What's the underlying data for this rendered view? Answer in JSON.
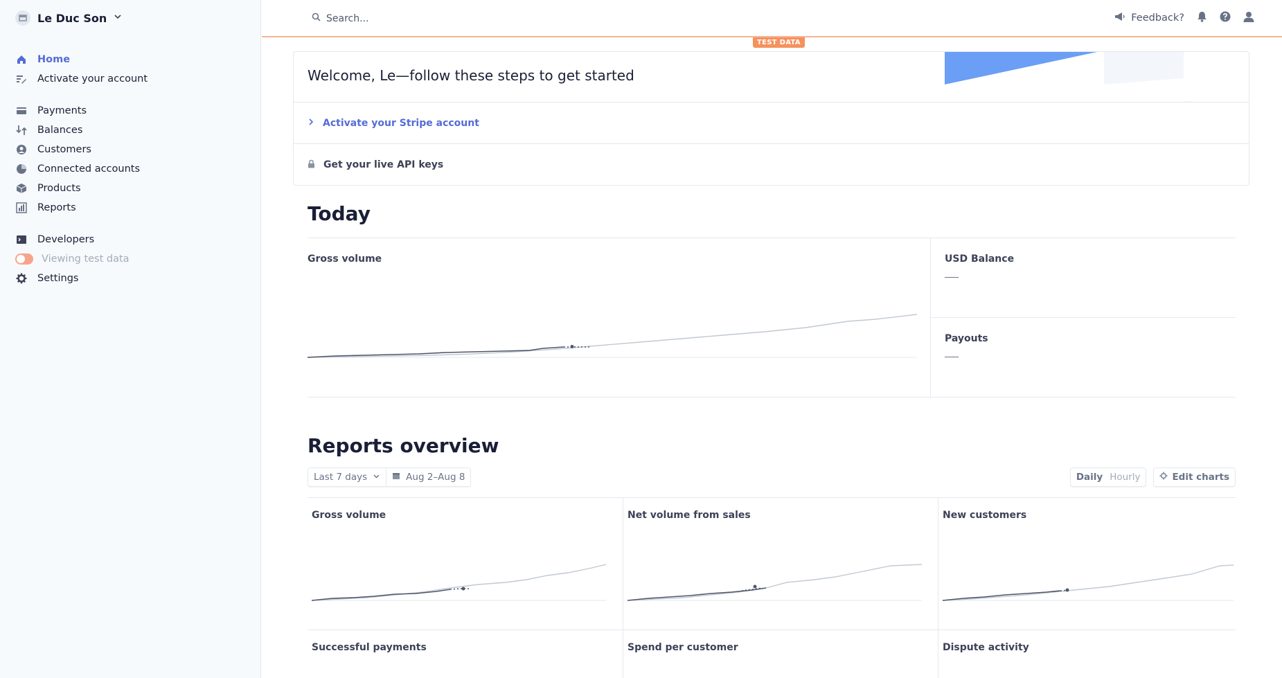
{
  "account": {
    "name": "Le Duc Son"
  },
  "sidebar": {
    "items": [
      {
        "label": "Home",
        "icon": "home-icon",
        "state": "active"
      },
      {
        "label": "Activate your account",
        "icon": "edit-list-icon"
      },
      {
        "label": "Payments",
        "icon": "payments-icon"
      },
      {
        "label": "Balances",
        "icon": "balances-icon"
      },
      {
        "label": "Customers",
        "icon": "customers-icon"
      },
      {
        "label": "Connected accounts",
        "icon": "connected-accounts-icon"
      },
      {
        "label": "Products",
        "icon": "products-icon"
      },
      {
        "label": "Reports",
        "icon": "reports-icon"
      },
      {
        "label": "Developers",
        "icon": "terminal-icon"
      },
      {
        "label": "Viewing test data",
        "icon": "toggle",
        "state": "on"
      },
      {
        "label": "Settings",
        "icon": "gear-icon"
      }
    ]
  },
  "topbar": {
    "search_placeholder": "Search...",
    "feedback_label": "Feedback?",
    "test_badge": "TEST DATA"
  },
  "welcome": {
    "title": "Welcome, Le—follow these steps to get started",
    "steps": [
      {
        "label": "Activate your Stripe account",
        "icon": "chevron-right-icon"
      },
      {
        "label": "Get your live API keys",
        "icon": "lock-icon"
      }
    ]
  },
  "today": {
    "heading": "Today",
    "gross_volume_label": "Gross volume",
    "usd_balance_label": "USD Balance",
    "payouts_label": "Payouts"
  },
  "reports": {
    "heading": "Reports overview",
    "range_label": "Last 7 days",
    "date_range": "Aug 2–Aug 8",
    "daily_label": "Daily",
    "hourly_label": "Hourly",
    "edit_label": "Edit charts",
    "cards": [
      {
        "title": "Gross volume"
      },
      {
        "title": "Net volume from sales"
      },
      {
        "title": "New customers"
      },
      {
        "title": "Successful payments"
      },
      {
        "title": "Spend per customer"
      },
      {
        "title": "Dispute activity"
      }
    ]
  },
  "colors": {
    "accent": "#556cd6",
    "test_orange": "#f5925e",
    "sidebar_bg": "#f7fafc"
  }
}
